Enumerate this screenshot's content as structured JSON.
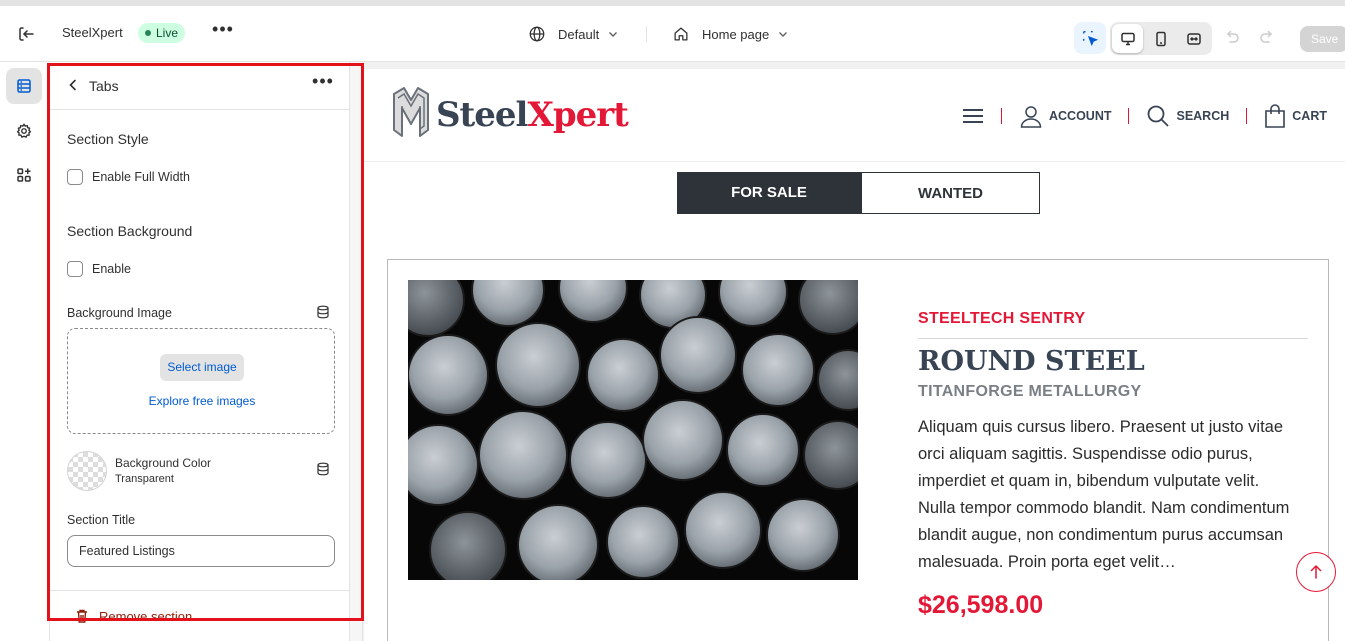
{
  "topbar": {
    "store_name": "SteelXpert",
    "status": "Live",
    "theme": "Default",
    "page": "Home page",
    "save_label": "Save"
  },
  "panel": {
    "title": "Tabs",
    "section_style_heading": "Section Style",
    "full_width_label": "Enable Full Width",
    "full_width_checked": false,
    "section_background_heading": "Section Background",
    "enable_label": "Enable",
    "enable_checked": false,
    "background_image_label": "Background Image",
    "select_image_label": "Select image",
    "explore_images_label": "Explore free images",
    "background_color_label": "Background Color",
    "background_color_value": "Transparent",
    "section_title_label": "Section Title",
    "section_title_value": "Featured Listings",
    "remove_section_label": "Remove section"
  },
  "preview": {
    "logo_part1": "Steel",
    "logo_part2": "Xpert",
    "nav": {
      "account": "ACCOUNT",
      "search": "SEARCH",
      "cart": "CART"
    },
    "tabs": [
      "FOR SALE",
      "WANTED"
    ],
    "card": {
      "brand": "STEELTECH SENTRY",
      "title": "ROUND STEEL",
      "subtitle": "TITANFORGE METALLURGY",
      "description": "Aliquam quis cursus libero. Praesent ut justo vitae orci aliquam sagittis. Suspendisse odio purus, imperdiet et quam in, bibendum vulputate velit. Nulla tempor commodo blandit. Nam condimentum blandit augue, non condimentum purus accumsan malesuada. Proin porta eget velit…",
      "price": "$26,598.00"
    }
  },
  "colors": {
    "brand_red": "#e31837",
    "brand_dark": "#384454",
    "highlight": "#e3111a",
    "link_blue": "#005bd3"
  }
}
